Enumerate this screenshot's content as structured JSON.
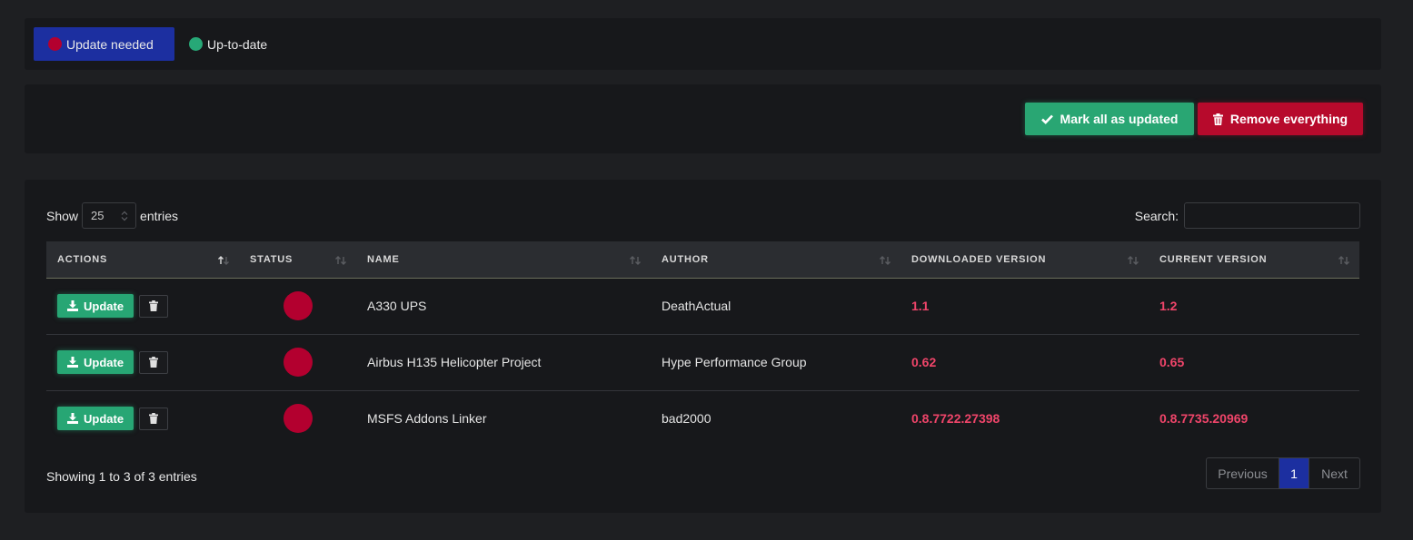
{
  "filters": {
    "update_needed_label": "Update needed",
    "up_to_date_label": "Up-to-date"
  },
  "toolbar": {
    "mark_all_label": "Mark all as updated",
    "remove_all_label": "Remove everything"
  },
  "table_controls": {
    "show_label": "Show",
    "page_size": "25",
    "entries_label": "entries",
    "search_label": "Search:",
    "search_value": ""
  },
  "table": {
    "columns": [
      "ACTIONS",
      "STATUS",
      "NAME",
      "AUTHOR",
      "DOWNLOADED VERSION",
      "CURRENT VERSION"
    ],
    "update_button_label": "Update",
    "rows": [
      {
        "status": "update-needed",
        "name": "A330 UPS",
        "author": "DeathActual",
        "downloaded_version": "1.1",
        "current_version": "1.2"
      },
      {
        "status": "update-needed",
        "name": "Airbus H135 Helicopter Project",
        "author": "Hype Performance Group",
        "downloaded_version": "0.62",
        "current_version": "0.65"
      },
      {
        "status": "update-needed",
        "name": "MSFS Addons Linker",
        "author": "bad2000",
        "downloaded_version": "0.8.7722.27398",
        "current_version": "0.8.7735.20969"
      }
    ]
  },
  "footer": {
    "info": "Showing 1 to 3 of 3 entries",
    "previous_label": "Previous",
    "current_page": "1",
    "next_label": "Next"
  },
  "colors": {
    "accent_blue": "#1c2fa0",
    "success_green": "#27a674",
    "danger_red": "#b70a2c",
    "status_red": "#b3002f",
    "version_pink": "#f0456a"
  },
  "icons": {
    "mark_all": "check-icon",
    "remove_all": "trash-icon",
    "update": "download-icon",
    "delete": "trash-icon"
  }
}
